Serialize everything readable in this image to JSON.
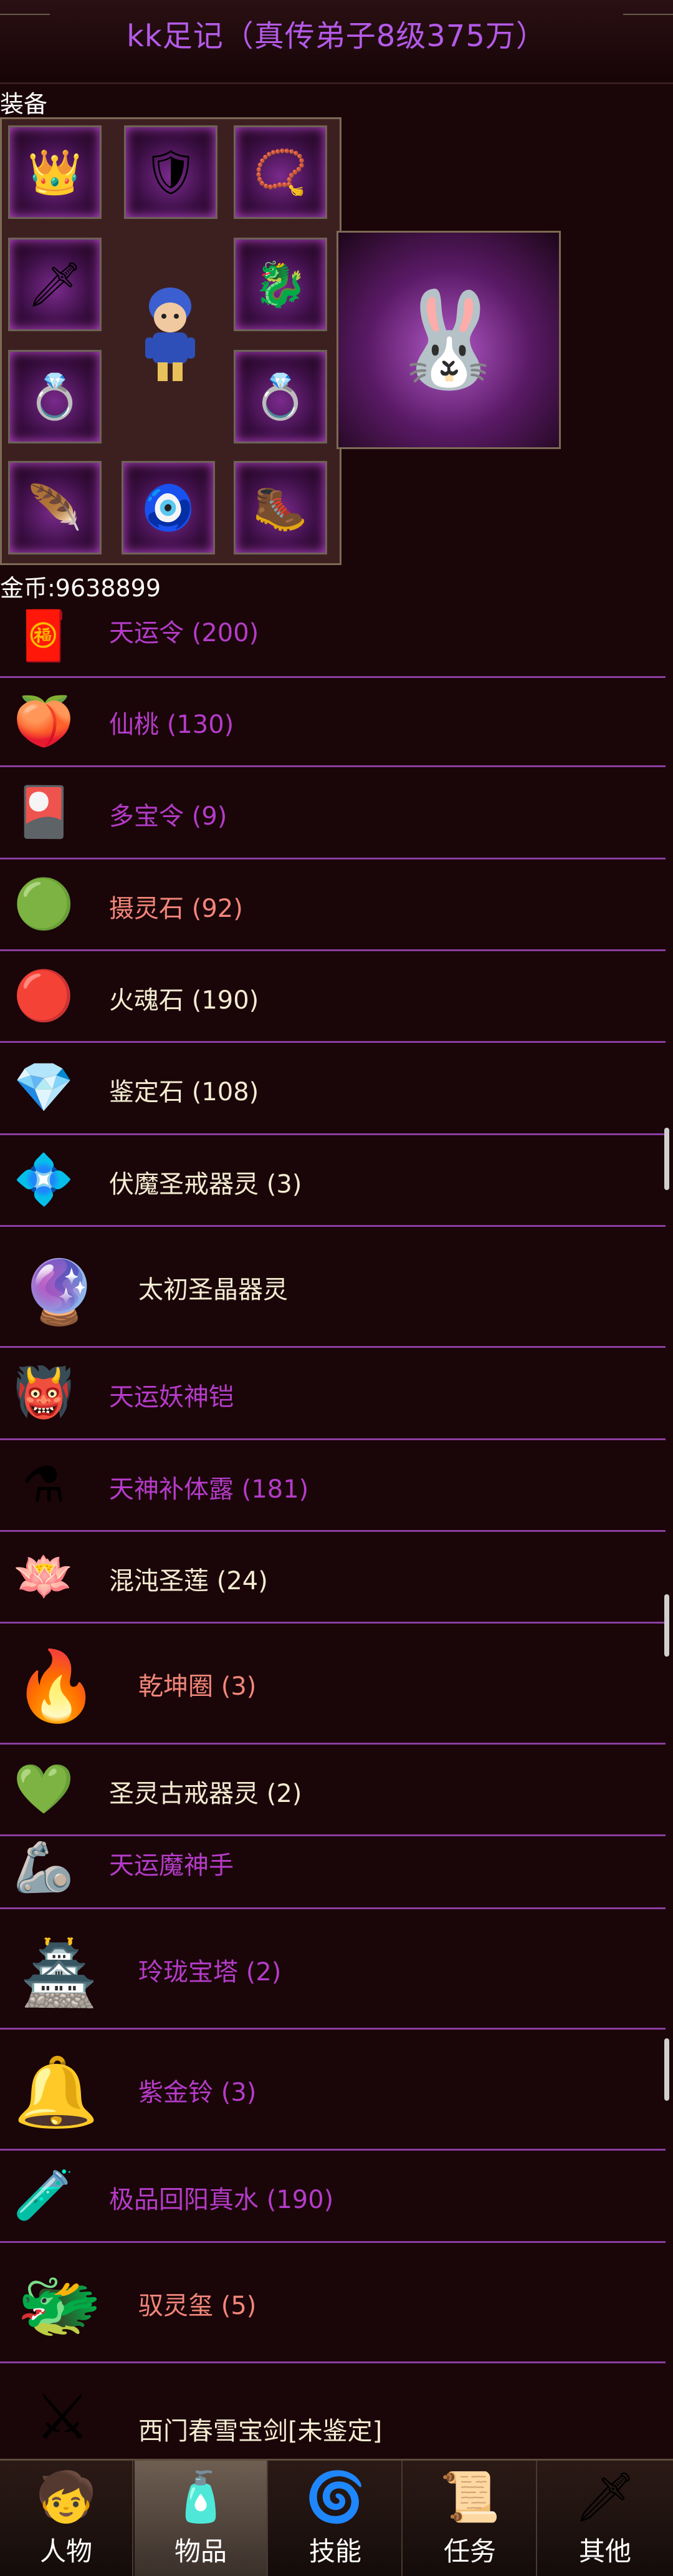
{
  "title": "kk足记（真传弟子8级375万）",
  "equipment_label": "装备",
  "gold": "金币:9638899",
  "items": [
    {
      "name": "天运令 (200)",
      "color": "purple",
      "icon": "token-icon"
    },
    {
      "name": "仙桃 (130)",
      "color": "purple",
      "icon": "peach-icon"
    },
    {
      "name": "多宝令 (9)",
      "color": "purple",
      "icon": "treasure-token-icon"
    },
    {
      "name": "摄灵石 (92)",
      "color": "red",
      "icon": "green-stone-icon"
    },
    {
      "name": "火魂石 (190)",
      "color": "white",
      "icon": "red-stone-icon"
    },
    {
      "name": "鉴定石 (108)",
      "color": "white",
      "icon": "rainbow-gem-icon"
    },
    {
      "name": "伏魔圣戒器灵 (3)",
      "color": "white",
      "icon": "ring-spirit-icon"
    },
    {
      "name": "太初圣晶器灵",
      "color": "white",
      "icon": "crystal-spirit-icon"
    },
    {
      "name": "天运妖神铠",
      "color": "purple",
      "icon": "armor-icon"
    },
    {
      "name": "天神补体露 (181)",
      "color": "purple",
      "icon": "potion-icon"
    },
    {
      "name": "混沌圣莲 (24)",
      "color": "white",
      "icon": "lotus-icon"
    },
    {
      "name": "乾坤圈 (3)",
      "color": "red",
      "icon": "fire-ring-icon"
    },
    {
      "name": "圣灵古戒器灵 (2)",
      "color": "white",
      "icon": "ancient-ring-icon"
    },
    {
      "name": "天运魔神手",
      "color": "purple",
      "icon": "gauntlet-icon"
    },
    {
      "name": "玲珑宝塔 (2)",
      "color": "purple",
      "icon": "pagoda-icon"
    },
    {
      "name": "紫金铃 (3)",
      "color": "purple",
      "icon": "bell-icon"
    },
    {
      "name": "极品回阳真水 (190)",
      "color": "purple",
      "icon": "elixir-icon"
    },
    {
      "name": "驭灵玺 (5)",
      "color": "red",
      "icon": "dragon-seal-icon"
    },
    {
      "name": "西门春雪宝剑[未鉴定]",
      "color": "white",
      "icon": "sword-icon"
    }
  ],
  "nav": [
    {
      "label": "人物",
      "icon": "character-icon",
      "active": false
    },
    {
      "label": "物品",
      "icon": "potion-bag-icon",
      "active": true
    },
    {
      "label": "技能",
      "icon": "skill-orb-icon",
      "active": false
    },
    {
      "label": "任务",
      "icon": "quest-icon",
      "active": false
    },
    {
      "label": "其他",
      "icon": "other-icon",
      "active": false
    }
  ],
  "colors": {
    "purple": "#b43cc8",
    "red": "#f2867a",
    "white": "#f4ecd2",
    "title": "#b45ae8",
    "divider": "#8a3ea0"
  }
}
